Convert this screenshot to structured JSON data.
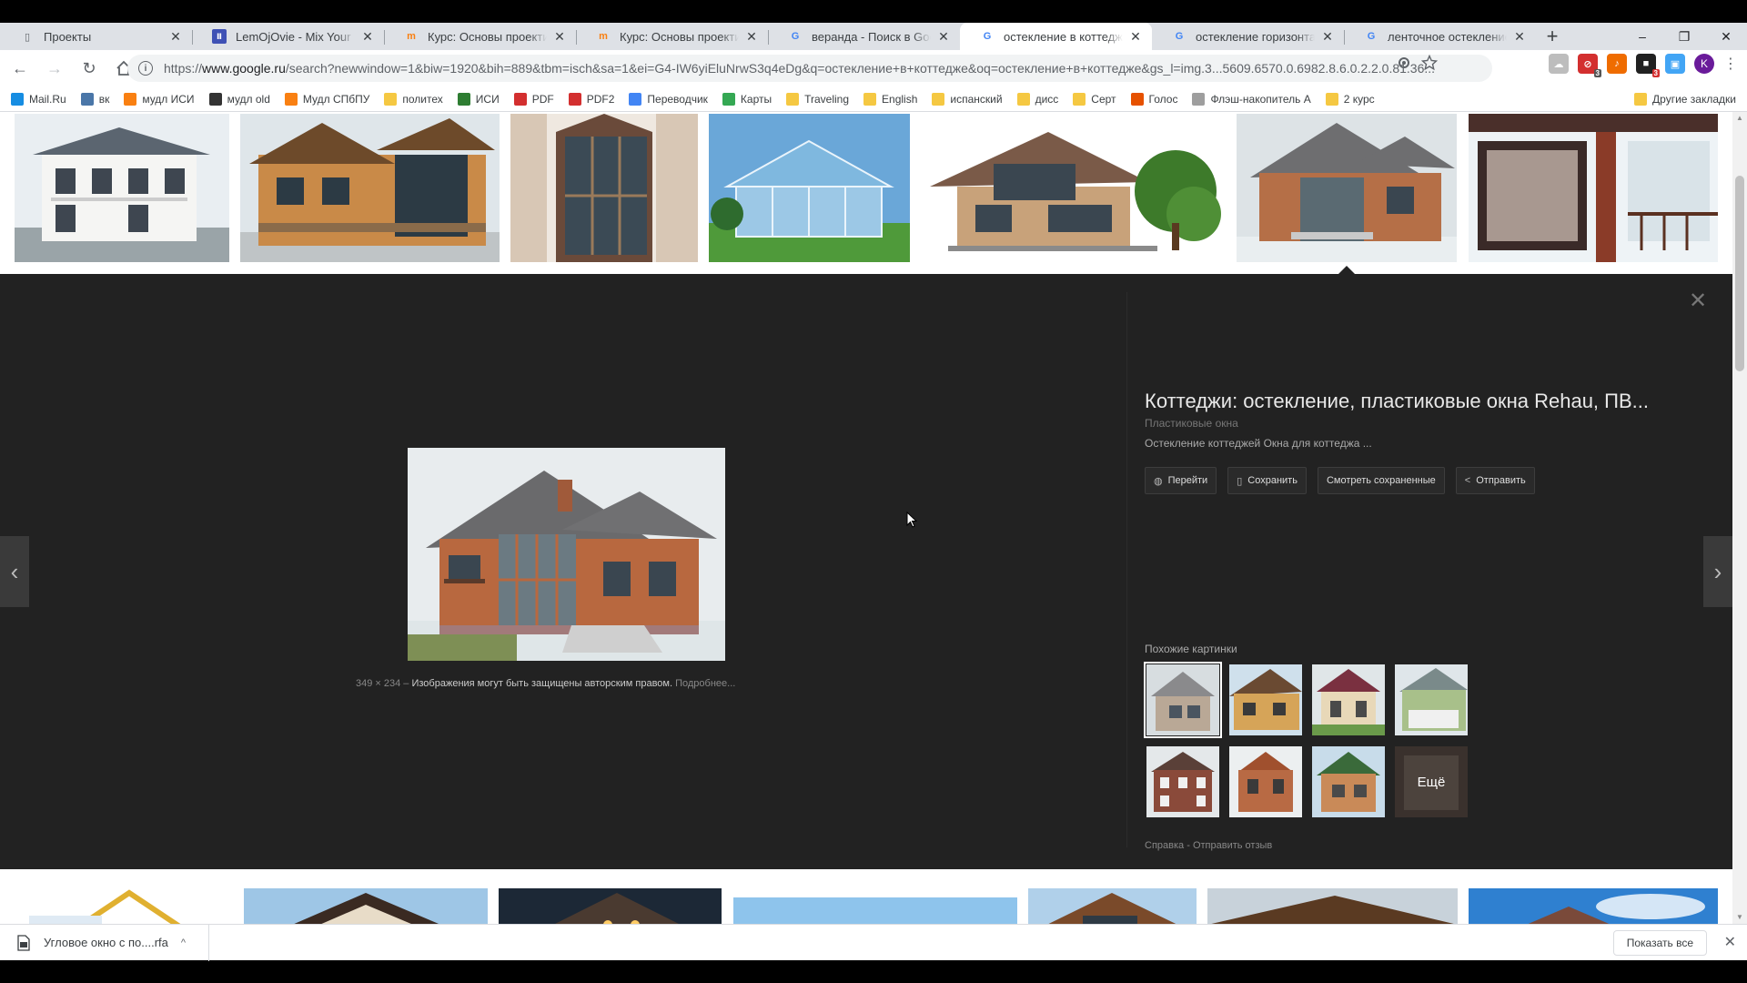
{
  "browser": {
    "tabs": [
      {
        "title": "Проекты",
        "favicon": "page-icon",
        "active": false
      },
      {
        "title": "LemOjOvie - Mix Your Life",
        "favicon": "blue-square-icon",
        "active": false
      },
      {
        "title": "Курс: Основы проектирования",
        "favicon": "moodle-icon",
        "active": false
      },
      {
        "title": "Курс: Основы проектирования",
        "favicon": "moodle-icon",
        "active": false
      },
      {
        "title": "веранда - Поиск в Google",
        "favicon": "google-icon",
        "active": false
      },
      {
        "title": "остекление в коттедже - Google",
        "favicon": "google-icon",
        "active": true
      },
      {
        "title": "остекление горизонтальное",
        "favicon": "google-icon",
        "active": false
      },
      {
        "title": "ленточное остекление - Google",
        "favicon": "google-icon",
        "active": false
      }
    ],
    "new_tab": "+",
    "window_controls": [
      "–",
      "❐",
      "✕"
    ],
    "url_prefix": "https://",
    "url_host": "www.google.ru",
    "url_rest": "/search?newwindow=1&biw=1920&bih=889&tbm=isch&sa=1&ei=G4-IW6yiEluNrwS3q4eD​g&q=остекление+в+коттедже&oq=остекление+в+коттедже&gs_l=img.3...5609.6570.0.6982.8.6.0.2.2.0.81.36...",
    "avatar_letter": "K",
    "badge_count": "3"
  },
  "bookmarks": [
    {
      "label": "Mail.Ru",
      "icon": "mailru-icon",
      "color": "#168de2"
    },
    {
      "label": "вк",
      "icon": "vk-icon",
      "color": "#4a76a8"
    },
    {
      "label": "мудл ИСИ",
      "icon": "moodle-icon",
      "color": "#f98012"
    },
    {
      "label": "мудл old",
      "icon": "moodle-icon",
      "color": "#333333"
    },
    {
      "label": "Мудл СПбПУ",
      "icon": "moodle-icon",
      "color": "#f98012"
    },
    {
      "label": "политех",
      "icon": "folder-icon",
      "color": "#f5c842"
    },
    {
      "label": "ИСИ",
      "icon": "isi-icon",
      "color": "#2e7d32"
    },
    {
      "label": "PDF",
      "icon": "pdf-icon",
      "color": "#d32f2f"
    },
    {
      "label": "PDF2",
      "icon": "pdf-icon",
      "color": "#d32f2f"
    },
    {
      "label": "Переводчик",
      "icon": "translate-icon",
      "color": "#4285f4"
    },
    {
      "label": "Карты",
      "icon": "maps-icon",
      "color": "#34a853"
    },
    {
      "label": "Traveling",
      "icon": "folder-icon",
      "color": "#f5c842"
    },
    {
      "label": "English",
      "icon": "folder-icon",
      "color": "#f5c842"
    },
    {
      "label": "испанский",
      "icon": "folder-icon",
      "color": "#f5c842"
    },
    {
      "label": "дисс",
      "icon": "folder-icon",
      "color": "#f5c842"
    },
    {
      "label": "Серт",
      "icon": "folder-icon",
      "color": "#f5c842"
    },
    {
      "label": "Голос",
      "icon": "voice-icon",
      "color": "#e65100"
    },
    {
      "label": "Флэш-накопитель А",
      "icon": "page-icon",
      "color": "#9e9e9e"
    },
    {
      "label": "2 курс",
      "icon": "folder-icon",
      "color": "#f5c842"
    }
  ],
  "bookmarks_other": "Другие закладки",
  "viewer": {
    "title": "Коттеджи: остекление, пластиковые окна Rehau, ПВ...",
    "site": "Пластиковые окна",
    "description": "Остекление коттеджей Окна для коттеджа ...",
    "actions": [
      {
        "label": "Перейти",
        "icon": "globe-icon"
      },
      {
        "label": "Сохранить",
        "icon": "bookmark-icon"
      },
      {
        "label": "Смотреть сохраненные",
        "icon": ""
      },
      {
        "label": "Отправить",
        "icon": "share-icon"
      }
    ],
    "dimensions": "349 × 234",
    "sep": " – ",
    "copyright": "Изображения могут быть защищены авторским правом.",
    "more": "Подробнее...",
    "similar_label": "Похожие картинки",
    "similar_more": "Ещё",
    "help": "Справка",
    "feedback_sep": " - ",
    "feedback": "Отправить отзыв"
  },
  "downloads": {
    "file": "Угловое окно с по....rfa",
    "show_all": "Показать все"
  }
}
